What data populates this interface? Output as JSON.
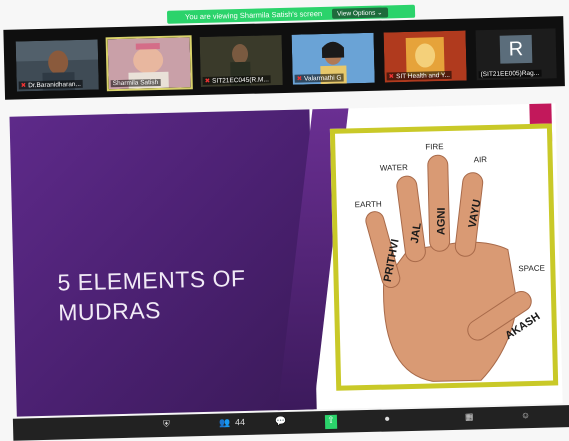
{
  "banner": {
    "text": "You are viewing Sharmila Satish's screen",
    "options": "View Options ⌄"
  },
  "participants": [
    {
      "name": "Dr.Baranidharan...",
      "muted": true,
      "type": "video",
      "bg": "#3f4b55"
    },
    {
      "name": "Sharmila Satish",
      "muted": false,
      "type": "video",
      "bg": "#c9a0a8"
    },
    {
      "name": "SIT21EC045(R.M...",
      "muted": true,
      "type": "video",
      "bg": "#3a3a2a"
    },
    {
      "name": "Valarmathi G",
      "muted": true,
      "type": "video",
      "bg": "#6aa3d6"
    },
    {
      "name": "SIT Health and Y...",
      "muted": true,
      "type": "video",
      "bg": "#b03a1e"
    },
    {
      "name": "(SIT21EE005)Rag...",
      "muted": false,
      "type": "avatar",
      "initial": "R",
      "bg": "#5b6d7b"
    }
  ],
  "slide": {
    "title_line1": "5 ELEMENTS OF",
    "title_line2": "MUDRAS",
    "labels": {
      "earth": "EARTH",
      "water": "WATER",
      "fire": "FIRE",
      "air": "AIR",
      "space": "SPACE",
      "prithvi": "PRITHVI",
      "jal": "JAL",
      "agni": "AGNI",
      "vayu": "VAYU",
      "akash": "AKASH"
    }
  },
  "toolbar": {
    "participants_count": "44"
  },
  "colors": {
    "banner": "#2bd36b",
    "slide_purple": "#4a2070",
    "frame_yellow": "#c9c928",
    "pink": "#c2185b"
  }
}
